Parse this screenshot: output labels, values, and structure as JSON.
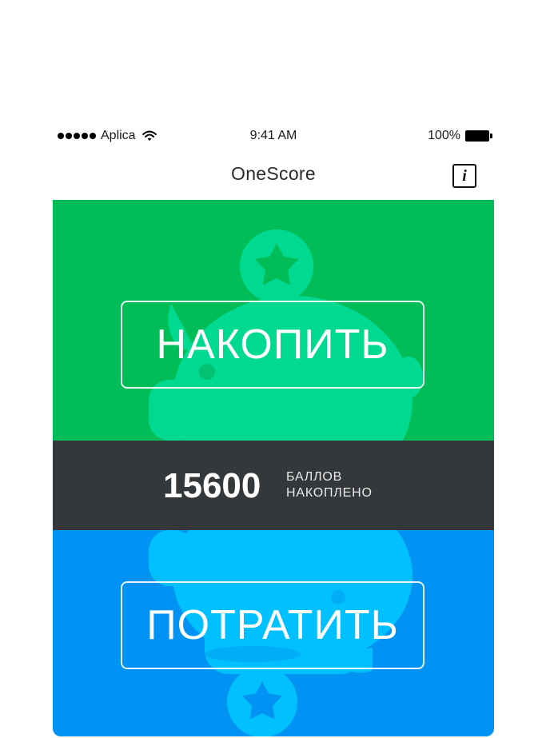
{
  "status_bar": {
    "carrier": "Aplica",
    "time": "9:41 AM",
    "battery": "100%"
  },
  "nav": {
    "title": "OneScore",
    "info_icon_label": "i"
  },
  "earn": {
    "label": "НАКОПИТЬ"
  },
  "balance": {
    "points": "15600",
    "caption_line1": "БАЛЛОВ",
    "caption_line2": "НАКОПЛЕНО"
  },
  "spend": {
    "label": "ПОТРАТИТЬ"
  },
  "colors": {
    "earn_panel": "#00bd57",
    "balance_panel": "#34383a",
    "spend_panel": "#0093f4",
    "earn_illustration": "#00da91",
    "spend_illustration": "#00c0ff"
  },
  "icons": {
    "status": [
      "signal-dots-icon",
      "wifi-icon",
      "battery-icon"
    ],
    "nav": [
      "info-icon"
    ],
    "illustration": [
      "coin-star-icon",
      "piggy-bank-icon"
    ]
  }
}
